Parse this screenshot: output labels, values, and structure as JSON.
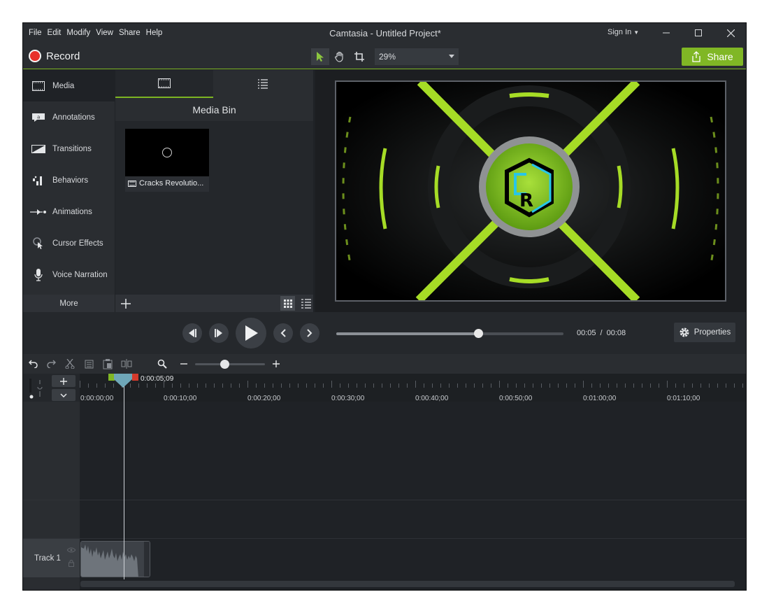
{
  "menu": [
    "File",
    "Edit",
    "Modify",
    "View",
    "Share",
    "Help"
  ],
  "window_title": "Camtasia - Untitled Project*",
  "sign_in": "Sign In",
  "record_label": "Record",
  "zoom_value": "29%",
  "share_label": "Share",
  "tools_nav": [
    {
      "label": "Media",
      "icon": "film-icon"
    },
    {
      "label": "Annotations",
      "icon": "annotation-icon"
    },
    {
      "label": "Transitions",
      "icon": "transition-icon"
    },
    {
      "label": "Behaviors",
      "icon": "behaviors-icon"
    },
    {
      "label": "Animations",
      "icon": "animation-icon"
    },
    {
      "label": "Cursor Effects",
      "icon": "cursor-icon"
    },
    {
      "label": "Voice Narration",
      "icon": "microphone-icon"
    }
  ],
  "more_label": "More",
  "media_bin": {
    "title": "Media Bin",
    "items": [
      {
        "name": "Cracks Revolutio..."
      }
    ]
  },
  "playback": {
    "current_time": "00:05",
    "separator": "/",
    "total_time": "00:08",
    "progress": 0.625
  },
  "properties_label": "Properties",
  "timeline": {
    "playhead_time": "0:00:05;09",
    "ruler_labels": [
      "0:00:00;00",
      "0:00:10;00",
      "0:00:20;00",
      "0:00:30;00",
      "0:00:40;00",
      "0:00:50;00",
      "0:01:00;00",
      "0:01:10;00"
    ],
    "zoom_level": 0.42
  },
  "tracks": [
    {
      "label": "Track 1"
    }
  ],
  "colors": {
    "accent": "#80b725",
    "record": "#e8312b"
  }
}
